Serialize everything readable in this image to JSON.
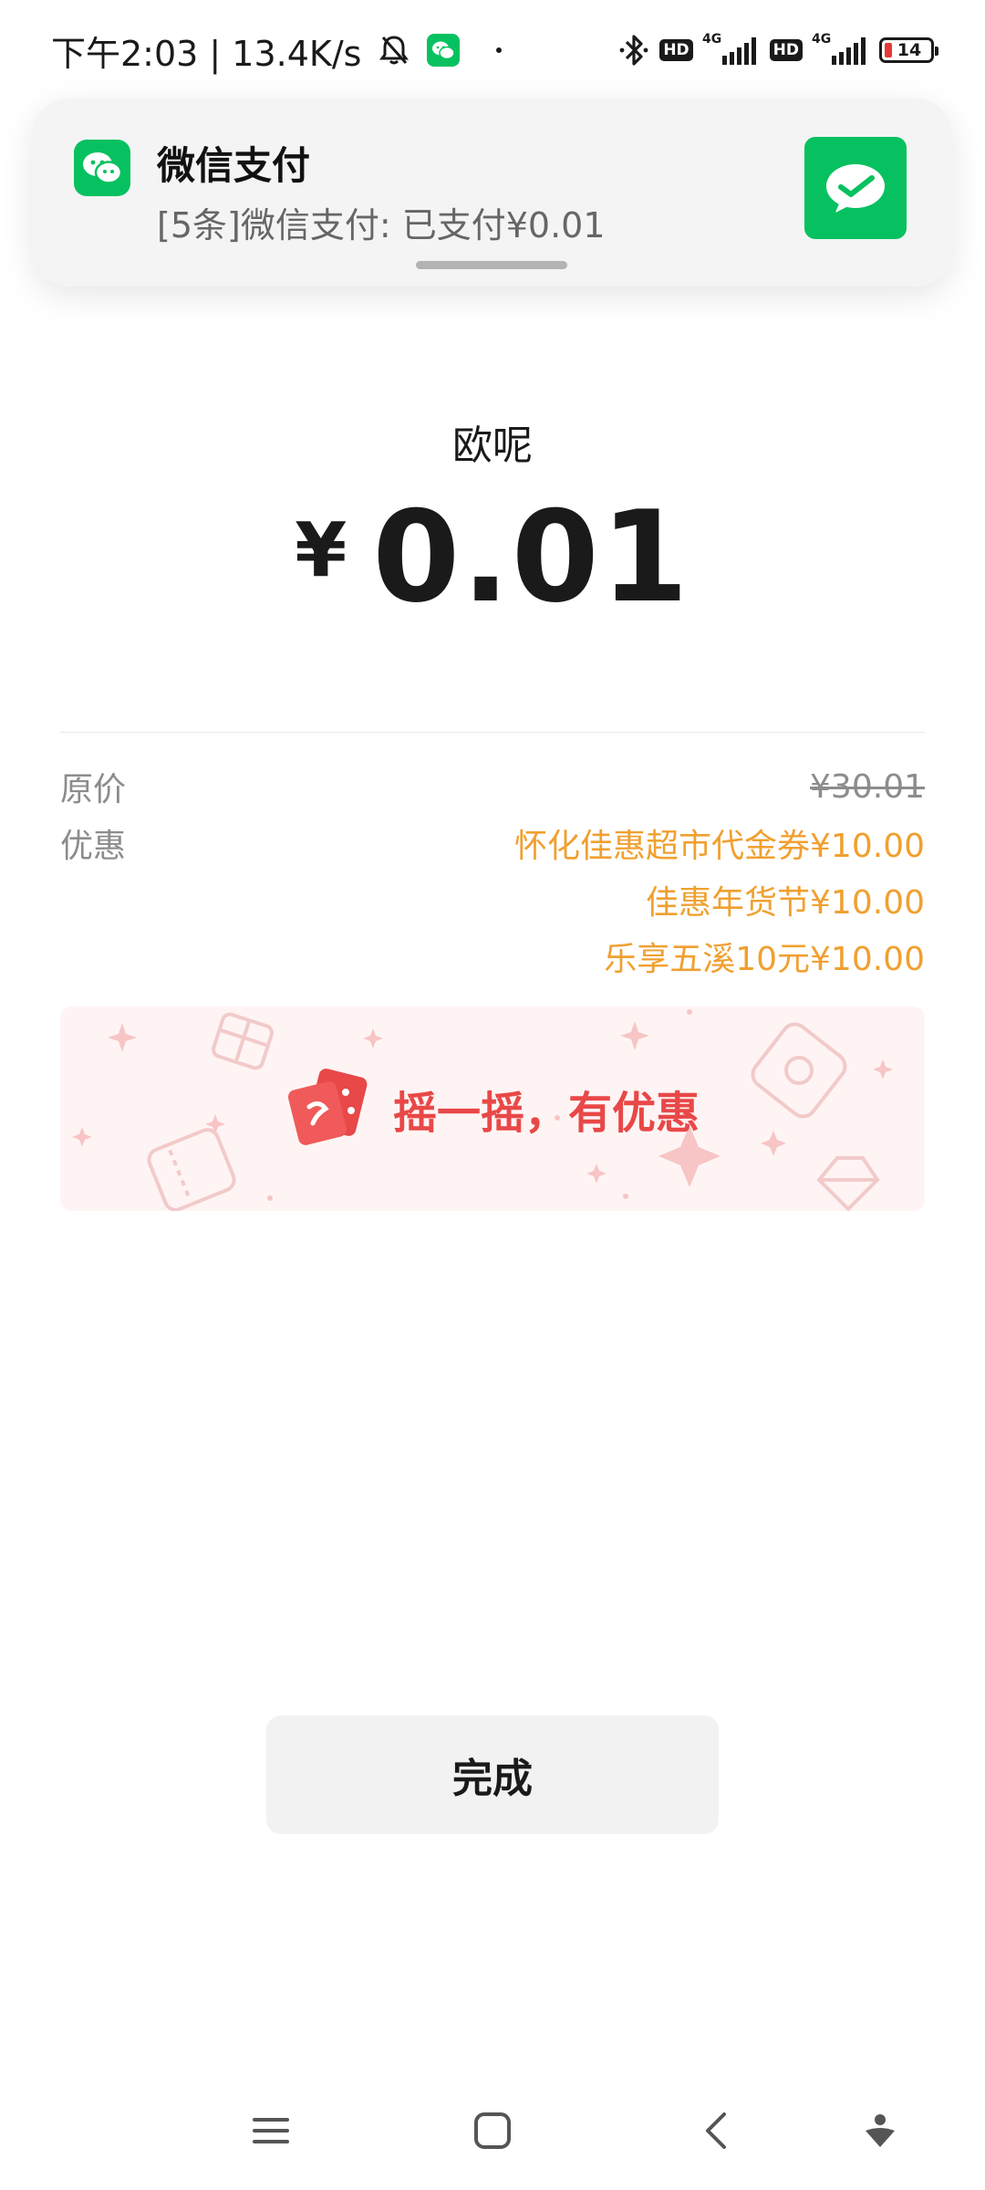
{
  "status_bar": {
    "time_speed": "下午2:03 | 13.4K/s",
    "battery": "14",
    "hd_label": "HD",
    "network_label": "4G"
  },
  "notification": {
    "app_name": "微信支付",
    "message": "[5条]微信支付: 已支付¥0.01"
  },
  "payment": {
    "merchant": "欧呢",
    "currency": "¥",
    "amount": "0.01"
  },
  "details": {
    "original_label": "原价",
    "original_price": "¥30.01",
    "discount_label": "优惠",
    "discounts": [
      "怀化佳惠超市代金券¥10.00",
      "佳惠年货节¥10.00",
      "乐享五溪10元¥10.00"
    ]
  },
  "banner": {
    "text": "摇一摇，有优惠"
  },
  "actions": {
    "done_label": "完成"
  },
  "colors": {
    "wechat_green": "#07c160",
    "discount_orange": "#f0a030",
    "banner_red": "#e84848"
  },
  "icons": {
    "notification_app": "wechat-icon",
    "notification_thumb": "wechat-pay-icon",
    "banner": "shake-coupon-icon",
    "nav": [
      "menu-icon",
      "home-icon",
      "back-icon",
      "assistant-icon"
    ]
  }
}
